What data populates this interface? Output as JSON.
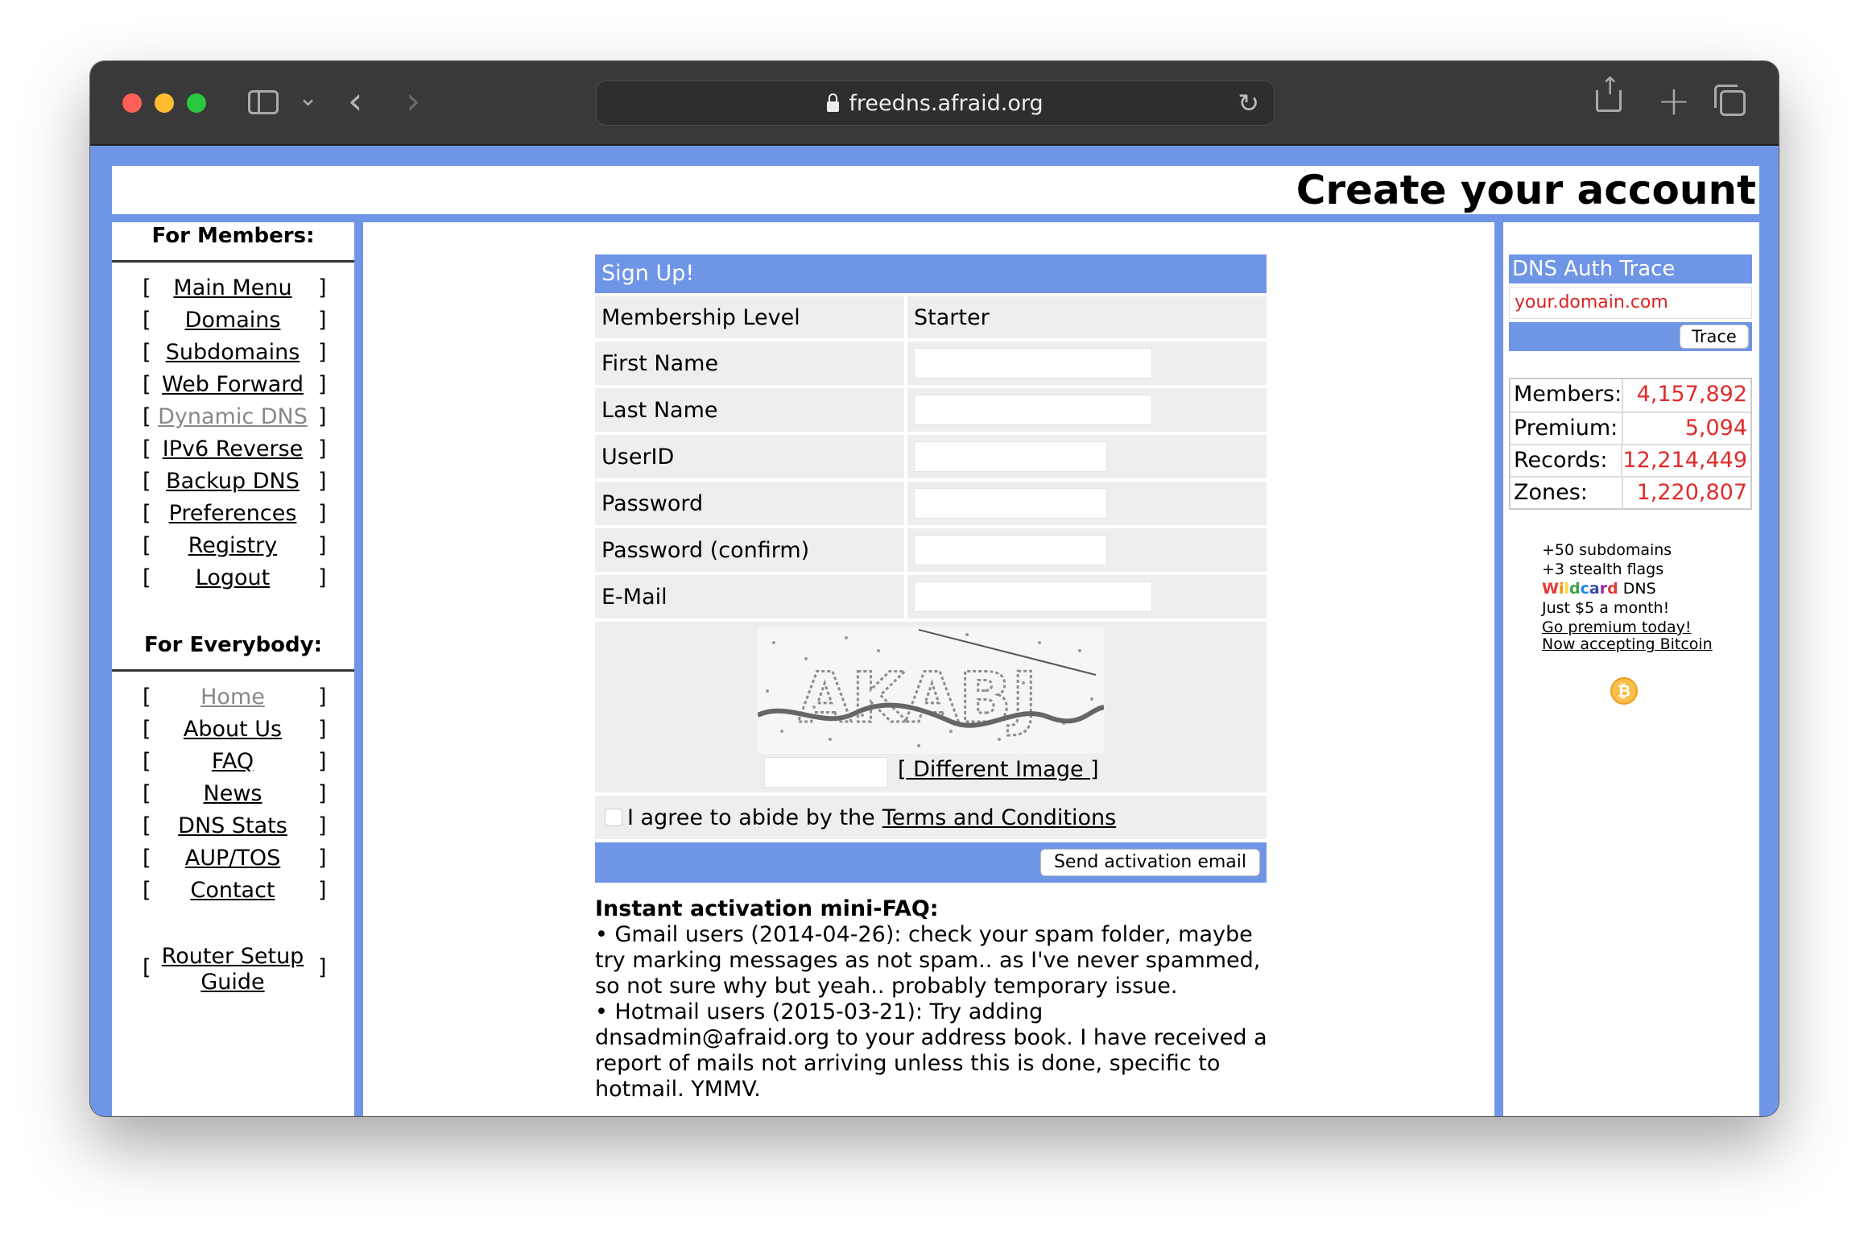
{
  "browser": {
    "url": "freedns.afraid.org"
  },
  "page": {
    "title": "Create your account"
  },
  "members_menu": {
    "heading": "For Members:",
    "items": [
      {
        "label": "Main Menu",
        "enabled": true
      },
      {
        "label": "Domains",
        "enabled": true
      },
      {
        "label": "Subdomains",
        "enabled": true
      },
      {
        "label": "Web Forward",
        "enabled": true
      },
      {
        "label": "Dynamic DNS",
        "enabled": false
      },
      {
        "label": "IPv6 Reverse",
        "enabled": true
      },
      {
        "label": "Backup DNS",
        "enabled": true
      },
      {
        "label": "Preferences",
        "enabled": true
      },
      {
        "label": "Registry",
        "enabled": true
      },
      {
        "label": "Logout",
        "enabled": true
      }
    ]
  },
  "everybody_menu": {
    "heading": "For Everybody:",
    "items": [
      {
        "label": "Home",
        "enabled": false
      },
      {
        "label": "About Us",
        "enabled": true
      },
      {
        "label": "FAQ",
        "enabled": true
      },
      {
        "label": "News",
        "enabled": true
      },
      {
        "label": "DNS Stats",
        "enabled": true
      },
      {
        "label": "AUP/TOS",
        "enabled": true
      },
      {
        "label": "Contact",
        "enabled": true
      }
    ],
    "router_line1": "Router Setup",
    "router_line2": "Guide"
  },
  "signup": {
    "heading": "Sign Up!",
    "membership_label": "Membership Level",
    "membership_value": "Starter",
    "first_name_label": "First Name",
    "last_name_label": "Last Name",
    "userid_label": "UserID",
    "password_label": "Password",
    "password_confirm_label": "Password (confirm)",
    "email_label": "E-Mail",
    "captcha_text": "AKABJ",
    "different_image": "[ Different Image ]",
    "agree_text": "I agree to abide by the",
    "terms_link": "Terms and Conditions",
    "submit": "Send activation email"
  },
  "faq": {
    "title": "Instant activation mini-FAQ:",
    "item1": "• Gmail users (2014-04-26): check your spam folder, maybe try marking messages as not spam.. as I've never spammed, so not sure why but yeah.. probably temporary issue.",
    "item2": "• Hotmail users (2015-03-21): Try adding dnsadmin@afraid.org to your address book. I have received a report of mails not arriving unless this is done, specific to hotmail. YMMV."
  },
  "trace": {
    "title": "DNS Auth Trace",
    "placeholder": "your.domain.com",
    "button": "Trace"
  },
  "stats": [
    {
      "label": "Members:",
      "value": "4,157,892"
    },
    {
      "label": "Premium:",
      "value": "5,094"
    },
    {
      "label": "Records:",
      "value": "12,214,449"
    },
    {
      "label": "Zones:",
      "value": "1,220,807"
    }
  ],
  "promo": {
    "line1": "+50 subdomains",
    "line2": "+3 stealth flags",
    "wildcard_letters": [
      "W",
      "i",
      "l",
      "d",
      "c",
      "a",
      "r",
      "d"
    ],
    "wildcard_colors": [
      "#e53935",
      "#fb8c00",
      "#fdd835",
      "#43a047",
      "#1e88e5",
      "#3949ab",
      "#8e24aa",
      "#e53935"
    ],
    "wildcard_suffix": " DNS",
    "line4": "Just $5 a month!",
    "link": "Go premium today!",
    "bitcoin": "Now accepting Bitcoin",
    "bitcoin_symbol": "₿"
  }
}
